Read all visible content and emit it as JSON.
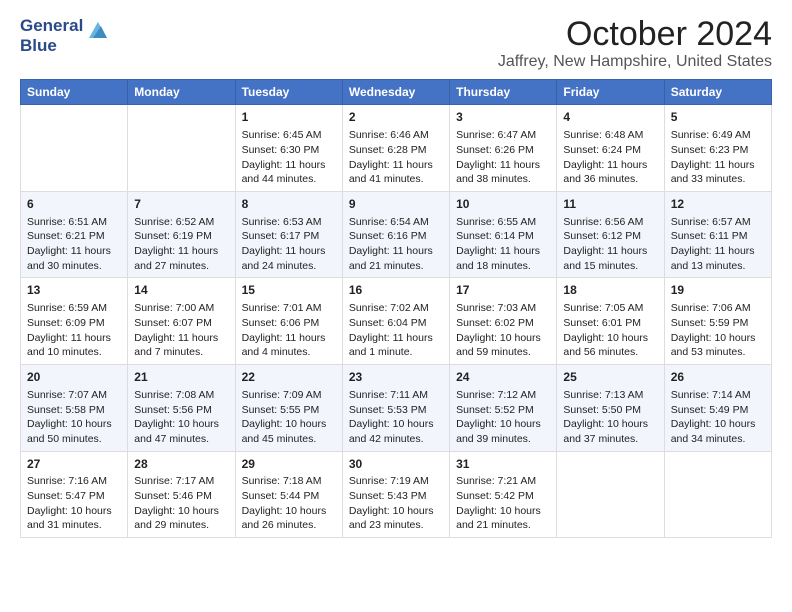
{
  "logo": {
    "line1": "General",
    "line2": "Blue"
  },
  "title": "October 2024",
  "subtitle": "Jaffrey, New Hampshire, United States",
  "days_of_week": [
    "Sunday",
    "Monday",
    "Tuesday",
    "Wednesday",
    "Thursday",
    "Friday",
    "Saturday"
  ],
  "weeks": [
    [
      {
        "num": "",
        "content": ""
      },
      {
        "num": "",
        "content": ""
      },
      {
        "num": "1",
        "content": "Sunrise: 6:45 AM\nSunset: 6:30 PM\nDaylight: 11 hours\nand 44 minutes."
      },
      {
        "num": "2",
        "content": "Sunrise: 6:46 AM\nSunset: 6:28 PM\nDaylight: 11 hours\nand 41 minutes."
      },
      {
        "num": "3",
        "content": "Sunrise: 6:47 AM\nSunset: 6:26 PM\nDaylight: 11 hours\nand 38 minutes."
      },
      {
        "num": "4",
        "content": "Sunrise: 6:48 AM\nSunset: 6:24 PM\nDaylight: 11 hours\nand 36 minutes."
      },
      {
        "num": "5",
        "content": "Sunrise: 6:49 AM\nSunset: 6:23 PM\nDaylight: 11 hours\nand 33 minutes."
      }
    ],
    [
      {
        "num": "6",
        "content": "Sunrise: 6:51 AM\nSunset: 6:21 PM\nDaylight: 11 hours\nand 30 minutes."
      },
      {
        "num": "7",
        "content": "Sunrise: 6:52 AM\nSunset: 6:19 PM\nDaylight: 11 hours\nand 27 minutes."
      },
      {
        "num": "8",
        "content": "Sunrise: 6:53 AM\nSunset: 6:17 PM\nDaylight: 11 hours\nand 24 minutes."
      },
      {
        "num": "9",
        "content": "Sunrise: 6:54 AM\nSunset: 6:16 PM\nDaylight: 11 hours\nand 21 minutes."
      },
      {
        "num": "10",
        "content": "Sunrise: 6:55 AM\nSunset: 6:14 PM\nDaylight: 11 hours\nand 18 minutes."
      },
      {
        "num": "11",
        "content": "Sunrise: 6:56 AM\nSunset: 6:12 PM\nDaylight: 11 hours\nand 15 minutes."
      },
      {
        "num": "12",
        "content": "Sunrise: 6:57 AM\nSunset: 6:11 PM\nDaylight: 11 hours\nand 13 minutes."
      }
    ],
    [
      {
        "num": "13",
        "content": "Sunrise: 6:59 AM\nSunset: 6:09 PM\nDaylight: 11 hours\nand 10 minutes."
      },
      {
        "num": "14",
        "content": "Sunrise: 7:00 AM\nSunset: 6:07 PM\nDaylight: 11 hours\nand 7 minutes."
      },
      {
        "num": "15",
        "content": "Sunrise: 7:01 AM\nSunset: 6:06 PM\nDaylight: 11 hours\nand 4 minutes."
      },
      {
        "num": "16",
        "content": "Sunrise: 7:02 AM\nSunset: 6:04 PM\nDaylight: 11 hours\nand 1 minute."
      },
      {
        "num": "17",
        "content": "Sunrise: 7:03 AM\nSunset: 6:02 PM\nDaylight: 10 hours\nand 59 minutes."
      },
      {
        "num": "18",
        "content": "Sunrise: 7:05 AM\nSunset: 6:01 PM\nDaylight: 10 hours\nand 56 minutes."
      },
      {
        "num": "19",
        "content": "Sunrise: 7:06 AM\nSunset: 5:59 PM\nDaylight: 10 hours\nand 53 minutes."
      }
    ],
    [
      {
        "num": "20",
        "content": "Sunrise: 7:07 AM\nSunset: 5:58 PM\nDaylight: 10 hours\nand 50 minutes."
      },
      {
        "num": "21",
        "content": "Sunrise: 7:08 AM\nSunset: 5:56 PM\nDaylight: 10 hours\nand 47 minutes."
      },
      {
        "num": "22",
        "content": "Sunrise: 7:09 AM\nSunset: 5:55 PM\nDaylight: 10 hours\nand 45 minutes."
      },
      {
        "num": "23",
        "content": "Sunrise: 7:11 AM\nSunset: 5:53 PM\nDaylight: 10 hours\nand 42 minutes."
      },
      {
        "num": "24",
        "content": "Sunrise: 7:12 AM\nSunset: 5:52 PM\nDaylight: 10 hours\nand 39 minutes."
      },
      {
        "num": "25",
        "content": "Sunrise: 7:13 AM\nSunset: 5:50 PM\nDaylight: 10 hours\nand 37 minutes."
      },
      {
        "num": "26",
        "content": "Sunrise: 7:14 AM\nSunset: 5:49 PM\nDaylight: 10 hours\nand 34 minutes."
      }
    ],
    [
      {
        "num": "27",
        "content": "Sunrise: 7:16 AM\nSunset: 5:47 PM\nDaylight: 10 hours\nand 31 minutes."
      },
      {
        "num": "28",
        "content": "Sunrise: 7:17 AM\nSunset: 5:46 PM\nDaylight: 10 hours\nand 29 minutes."
      },
      {
        "num": "29",
        "content": "Sunrise: 7:18 AM\nSunset: 5:44 PM\nDaylight: 10 hours\nand 26 minutes."
      },
      {
        "num": "30",
        "content": "Sunrise: 7:19 AM\nSunset: 5:43 PM\nDaylight: 10 hours\nand 23 minutes."
      },
      {
        "num": "31",
        "content": "Sunrise: 7:21 AM\nSunset: 5:42 PM\nDaylight: 10 hours\nand 21 minutes."
      },
      {
        "num": "",
        "content": ""
      },
      {
        "num": "",
        "content": ""
      }
    ]
  ]
}
